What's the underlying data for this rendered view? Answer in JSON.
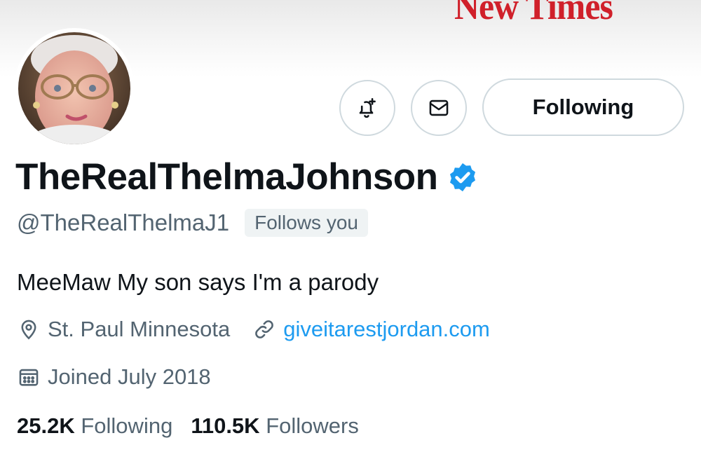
{
  "banner": {
    "text": "New Times"
  },
  "profile": {
    "display_name": "TheRealThelmaJohnson",
    "handle": "@TheRealThelmaJ1",
    "follows_you": "Follows you",
    "bio": "MeeMaw My son says I'm a parody",
    "location": "St. Paul Minnesota",
    "website": "giveitarestjordan.com",
    "joined": "Joined July 2018",
    "verified": true
  },
  "actions": {
    "notify_icon": "bell-plus-icon",
    "message_icon": "envelope-icon",
    "follow_label": "Following"
  },
  "stats": {
    "following_count": "25.2K",
    "following_label": "Following",
    "followers_count": "110.5K",
    "followers_label": "Followers"
  },
  "colors": {
    "accent": "#1d9bf0",
    "text_primary": "#0f1419",
    "text_secondary": "#536471",
    "banner_red": "#d0202a"
  }
}
